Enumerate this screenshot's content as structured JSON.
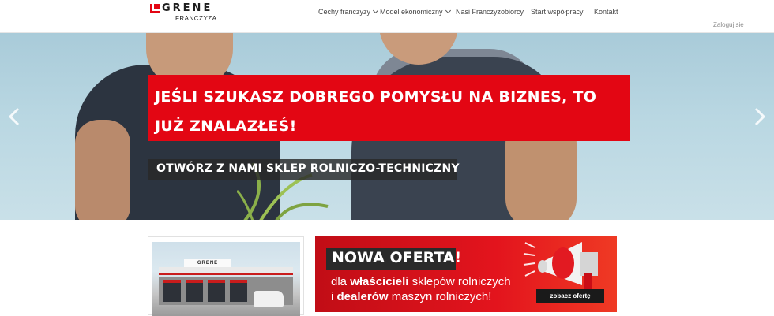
{
  "header": {
    "logo": {
      "brand": "GRENE",
      "sub": "FRANCZYZA"
    },
    "nav": [
      {
        "label": "Cechy franczyzy",
        "dropdown": true
      },
      {
        "label": "Model ekonomiczny",
        "dropdown": true
      },
      {
        "label": "Nasi Franczyzobiorcy",
        "dropdown": false
      },
      {
        "label": "Start współpracy",
        "dropdown": false
      },
      {
        "label": "Kontakt",
        "dropdown": false
      }
    ],
    "login_label": "Zaloguj się"
  },
  "hero": {
    "title": "JEŚLI SZUKASZ DOBREGO POMYSŁU NA BIZNES, TO JUŻ ZNALAZŁEŚ!",
    "subtitle": "OTWÓRZ Z NAMI SKLEP ROLNICZO-TECHNICZNY"
  },
  "store_photo": {
    "sign_text": "GRENE"
  },
  "offer": {
    "title": "NOWA OFERTA!",
    "line1_prefix": "dla ",
    "line1_bold": "właścicieli",
    "line1_suffix": " sklepów rolniczych",
    "line2_prefix": "i ",
    "line2_bold": "dealerów",
    "line2_suffix": " maszyn rolniczych!",
    "button_label": "zobacz ofertę"
  },
  "colors": {
    "brand_red": "#e30613",
    "dark_overlay": "#282828",
    "sky": "#b9d7e2"
  }
}
